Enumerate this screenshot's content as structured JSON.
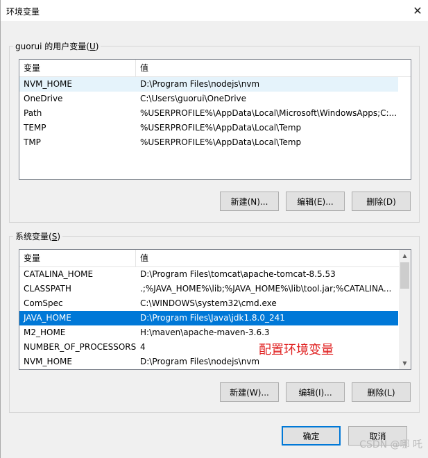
{
  "window": {
    "title": "环境变量",
    "close_glyph": "✕"
  },
  "user_vars": {
    "group_label_prefix": "guorui 的用户变量(",
    "group_label_key": "U",
    "group_label_suffix": ")",
    "columns": [
      "变量",
      "值"
    ],
    "rows": [
      [
        "NVM_HOME",
        "D:\\Program Files\\nodejs\\nvm"
      ],
      [
        "OneDrive",
        "C:\\Users\\guorui\\OneDrive"
      ],
      [
        "Path",
        "%USERPROFILE%\\AppData\\Local\\Microsoft\\WindowsApps;C:..."
      ],
      [
        "TEMP",
        "%USERPROFILE%\\AppData\\Local\\Temp"
      ],
      [
        "TMP",
        "%USERPROFILE%\\AppData\\Local\\Temp"
      ]
    ],
    "hover_row": 0,
    "buttons": {
      "new": "新建(N)...",
      "edit": "编辑(E)...",
      "delete": "删除(D)"
    }
  },
  "system_vars": {
    "group_label_prefix": "系统变量(",
    "group_label_key": "S",
    "group_label_suffix": ")",
    "columns": [
      "变量",
      "值"
    ],
    "rows": [
      [
        "CATALINA_HOME",
        "D:\\Program Files\\tomcat\\apache-tomcat-8.5.53"
      ],
      [
        "CLASSPATH",
        ".;%JAVA_HOME%\\lib;%JAVA_HOME%\\lib\\tool.jar;%CATALINA..."
      ],
      [
        "ComSpec",
        "C:\\WINDOWS\\system32\\cmd.exe"
      ],
      [
        "JAVA_HOME",
        "D:\\Program Files\\Java\\jdk1.8.0_241"
      ],
      [
        "M2_HOME",
        "H:\\maven\\apache-maven-3.6.3"
      ],
      [
        "NUMBER_OF_PROCESSORS",
        "4"
      ],
      [
        "NVM_HOME",
        "D:\\Program Files\\nodejs\\nvm"
      ]
    ],
    "selected_row": 3,
    "buttons": {
      "new": "新建(W)...",
      "edit": "编辑(I)...",
      "delete": "删除(L)"
    }
  },
  "annotation": "配置环境变量",
  "footer": {
    "ok": "确定",
    "cancel": "取消"
  },
  "watermark": "CSDN @哪 吒",
  "colors": {
    "selection": "#0078d7",
    "annotation": "#e02020",
    "default_border": "#0078d7"
  }
}
